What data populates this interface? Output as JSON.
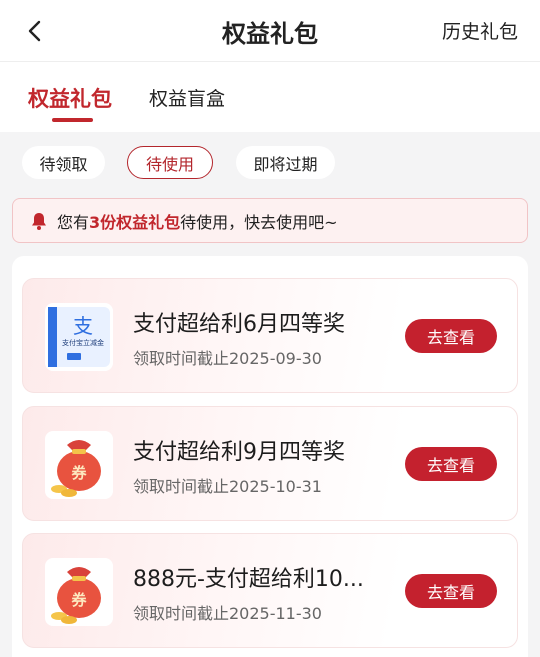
{
  "header": {
    "title": "权益礼包",
    "history_label": "历史礼包"
  },
  "tabs": [
    {
      "label": "权益礼包",
      "active": true
    },
    {
      "label": "权益盲盒",
      "active": false
    }
  ],
  "filters": [
    {
      "label": "待领取",
      "active": false
    },
    {
      "label": "待使用",
      "active": true
    },
    {
      "label": "即将过期",
      "active": false
    }
  ],
  "notice": {
    "prefix": "您有",
    "highlight": "3份权益礼包",
    "suffix": "待使用，快去使用吧~"
  },
  "items": [
    {
      "title": "支付超给利6月四等奖",
      "date": "领取时间截止2025-09-30",
      "button": "去查看",
      "icon": "alipay-coupon-icon"
    },
    {
      "title": "支付超给利9月四等奖",
      "date": "领取时间截止2025-10-31",
      "button": "去查看",
      "icon": "red-pouch-coupon-icon"
    },
    {
      "title": "888元-支付超给利10...",
      "date": "领取时间截止2025-11-30",
      "button": "去查看",
      "icon": "red-pouch-coupon-icon"
    }
  ],
  "thumb_text": {
    "alipay_label": "支付宝立减金",
    "pouch_label": "券"
  },
  "colors": {
    "accent": "#c1272d",
    "button": "#c4212e",
    "notice_bg": "#fdf1f1"
  }
}
